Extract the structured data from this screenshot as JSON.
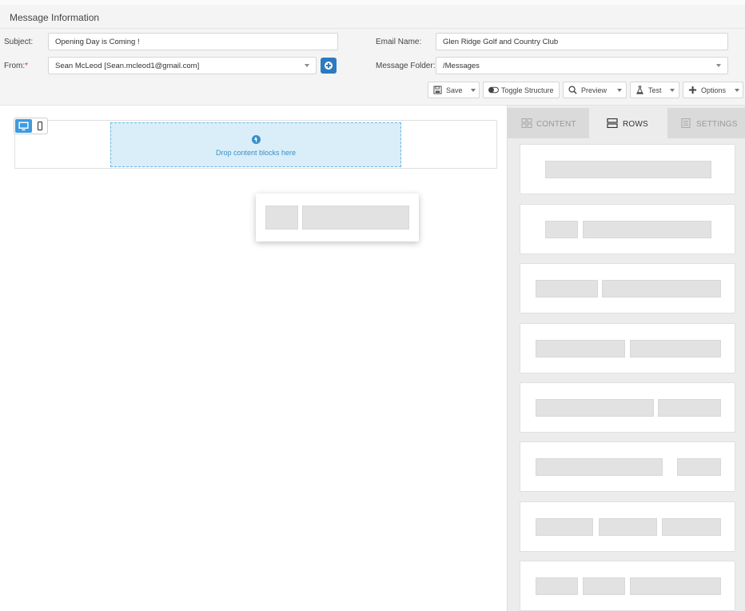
{
  "header": {
    "title": "Message Information"
  },
  "form": {
    "subject_label": "Subject:",
    "subject_value": "Opening Day is Coming !",
    "from_label": "From:",
    "from_required": "*",
    "from_value": "Sean McLeod  [Sean.mcleod1@gmail.com]",
    "email_name_label": "Email Name:",
    "email_name_value": "Glen Ridge Golf and Country Club",
    "folder_label": "Message Folder:",
    "folder_value": "/Messages"
  },
  "toolbar": {
    "save_label": "Save",
    "toggle_structure_label": "Toggle Structure",
    "preview_label": "Preview",
    "test_label": "Test",
    "options_label": "Options"
  },
  "canvas": {
    "dropzone_text": "Drop content blocks here"
  },
  "panel": {
    "tabs": [
      {
        "label": "CONTENT",
        "icon": "grid-icon",
        "active": false
      },
      {
        "label": "ROWS",
        "icon": "rows-icon",
        "active": true
      },
      {
        "label": "SETTINGS",
        "icon": "settings-icon",
        "active": false
      }
    ],
    "row_layouts": [
      "1 column",
      "2 columns (1/4 - 3/4)",
      "2 columns (1/3 - 2/3)",
      "2 columns (1/2 - 1/2)",
      "2 columns (2/3 - 1/3)",
      "2 columns (3/4 - 1/4)",
      "3 columns (1/3 - 1/3 - 1/3)",
      "3 columns (1/4 - 1/4 - 1/2)"
    ]
  },
  "colors": {
    "accent_blue": "#3d9be0",
    "button_blue": "#2d7bbf",
    "required_red": "#d9302c",
    "dropzone_bg": "#d9eef9"
  }
}
